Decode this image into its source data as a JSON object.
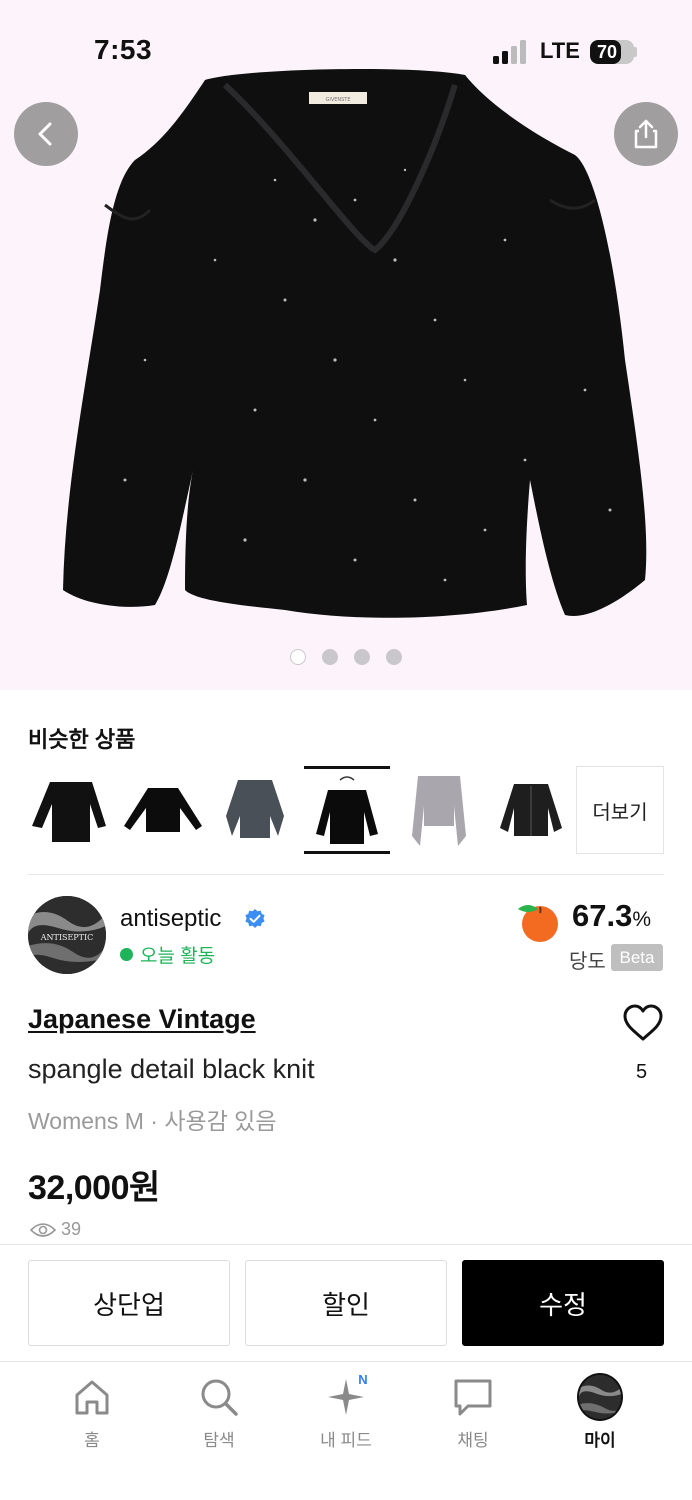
{
  "status_bar": {
    "time": "7:53",
    "network": "LTE",
    "battery": "70",
    "battery_level": 0.7
  },
  "gallery": {
    "image_count": 4,
    "current_index": 1
  },
  "similar": {
    "title": "비슷한 상품",
    "more_label": "더보기",
    "selected_index": 4
  },
  "seller": {
    "name": "antiseptic",
    "avatar_text": "ANTISEPTIC",
    "status": "오늘 활동",
    "sweetness_value": "67.3",
    "sweetness_unit": "%",
    "sweetness_label": "당도",
    "beta": "Beta"
  },
  "product": {
    "brand": "Japanese Vintage",
    "name": "spangle detail black knit",
    "meta": "Womens M · 사용감 있음",
    "price": "32,000원",
    "views": "39",
    "likes": "5",
    "tag_text": "GIVENSTE"
  },
  "actions": {
    "bump": "상단업",
    "discount": "할인",
    "edit": "수정"
  },
  "tabs": {
    "home": "홈",
    "search": "탐색",
    "feed": "내 피드",
    "feed_badge": "N",
    "chat": "채팅",
    "my": "마이"
  },
  "colors": {
    "active_green": "#1fb35a",
    "verified_blue": "#3b8ef3",
    "peach": "#f26b21",
    "hero_bg": "#fdf4fb"
  }
}
